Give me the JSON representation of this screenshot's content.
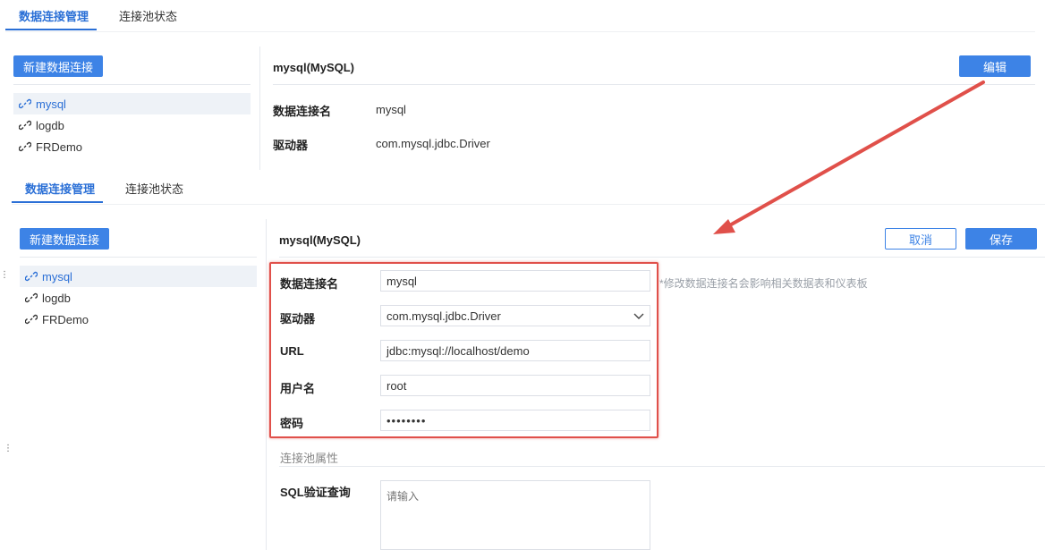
{
  "colors": {
    "accent": "#3d83e6",
    "active_tab": "#2a6fd6",
    "highlight": "#e0504a",
    "selected_bg": "#eef2f7"
  },
  "top": {
    "tabs": [
      {
        "label": "数据连接管理",
        "active": true
      },
      {
        "label": "连接池状态",
        "active": false
      }
    ],
    "new_button": "新建数据连接",
    "connections": [
      {
        "name": "mysql",
        "selected": true
      },
      {
        "name": "logdb"
      },
      {
        "name": "FRDemo"
      }
    ],
    "detail_title": "mysql(MySQL)",
    "edit_button": "编辑",
    "fields": [
      {
        "label": "数据连接名",
        "value": "mysql"
      },
      {
        "label": "驱动器",
        "value": "com.mysql.jdbc.Driver"
      }
    ]
  },
  "bottom": {
    "tabs": [
      {
        "label": "数据连接管理",
        "active": true
      },
      {
        "label": "连接池状态",
        "active": false
      }
    ],
    "new_button": "新建数据连接",
    "connections": [
      {
        "name": "mysql",
        "selected": true
      },
      {
        "name": "logdb"
      },
      {
        "name": "FRDemo"
      }
    ],
    "detail_title": "mysql(MySQL)",
    "cancel_button": "取消",
    "save_button": "保存",
    "form": {
      "name_label": "数据连接名",
      "name_value": "mysql",
      "name_hint": "*修改数据连接名会影响相关数据表和仪表板",
      "driver_label": "驱动器",
      "driver_value": "com.mysql.jdbc.Driver",
      "url_label": "URL",
      "url_value": "jdbc:mysql://localhost/demo",
      "user_label": "用户名",
      "user_value": "root",
      "password_label": "密码",
      "password_value": "••••••••"
    },
    "pool_section_title": "连接池属性",
    "sql_label": "SQL验证查询",
    "sql_placeholder": "请输入"
  }
}
